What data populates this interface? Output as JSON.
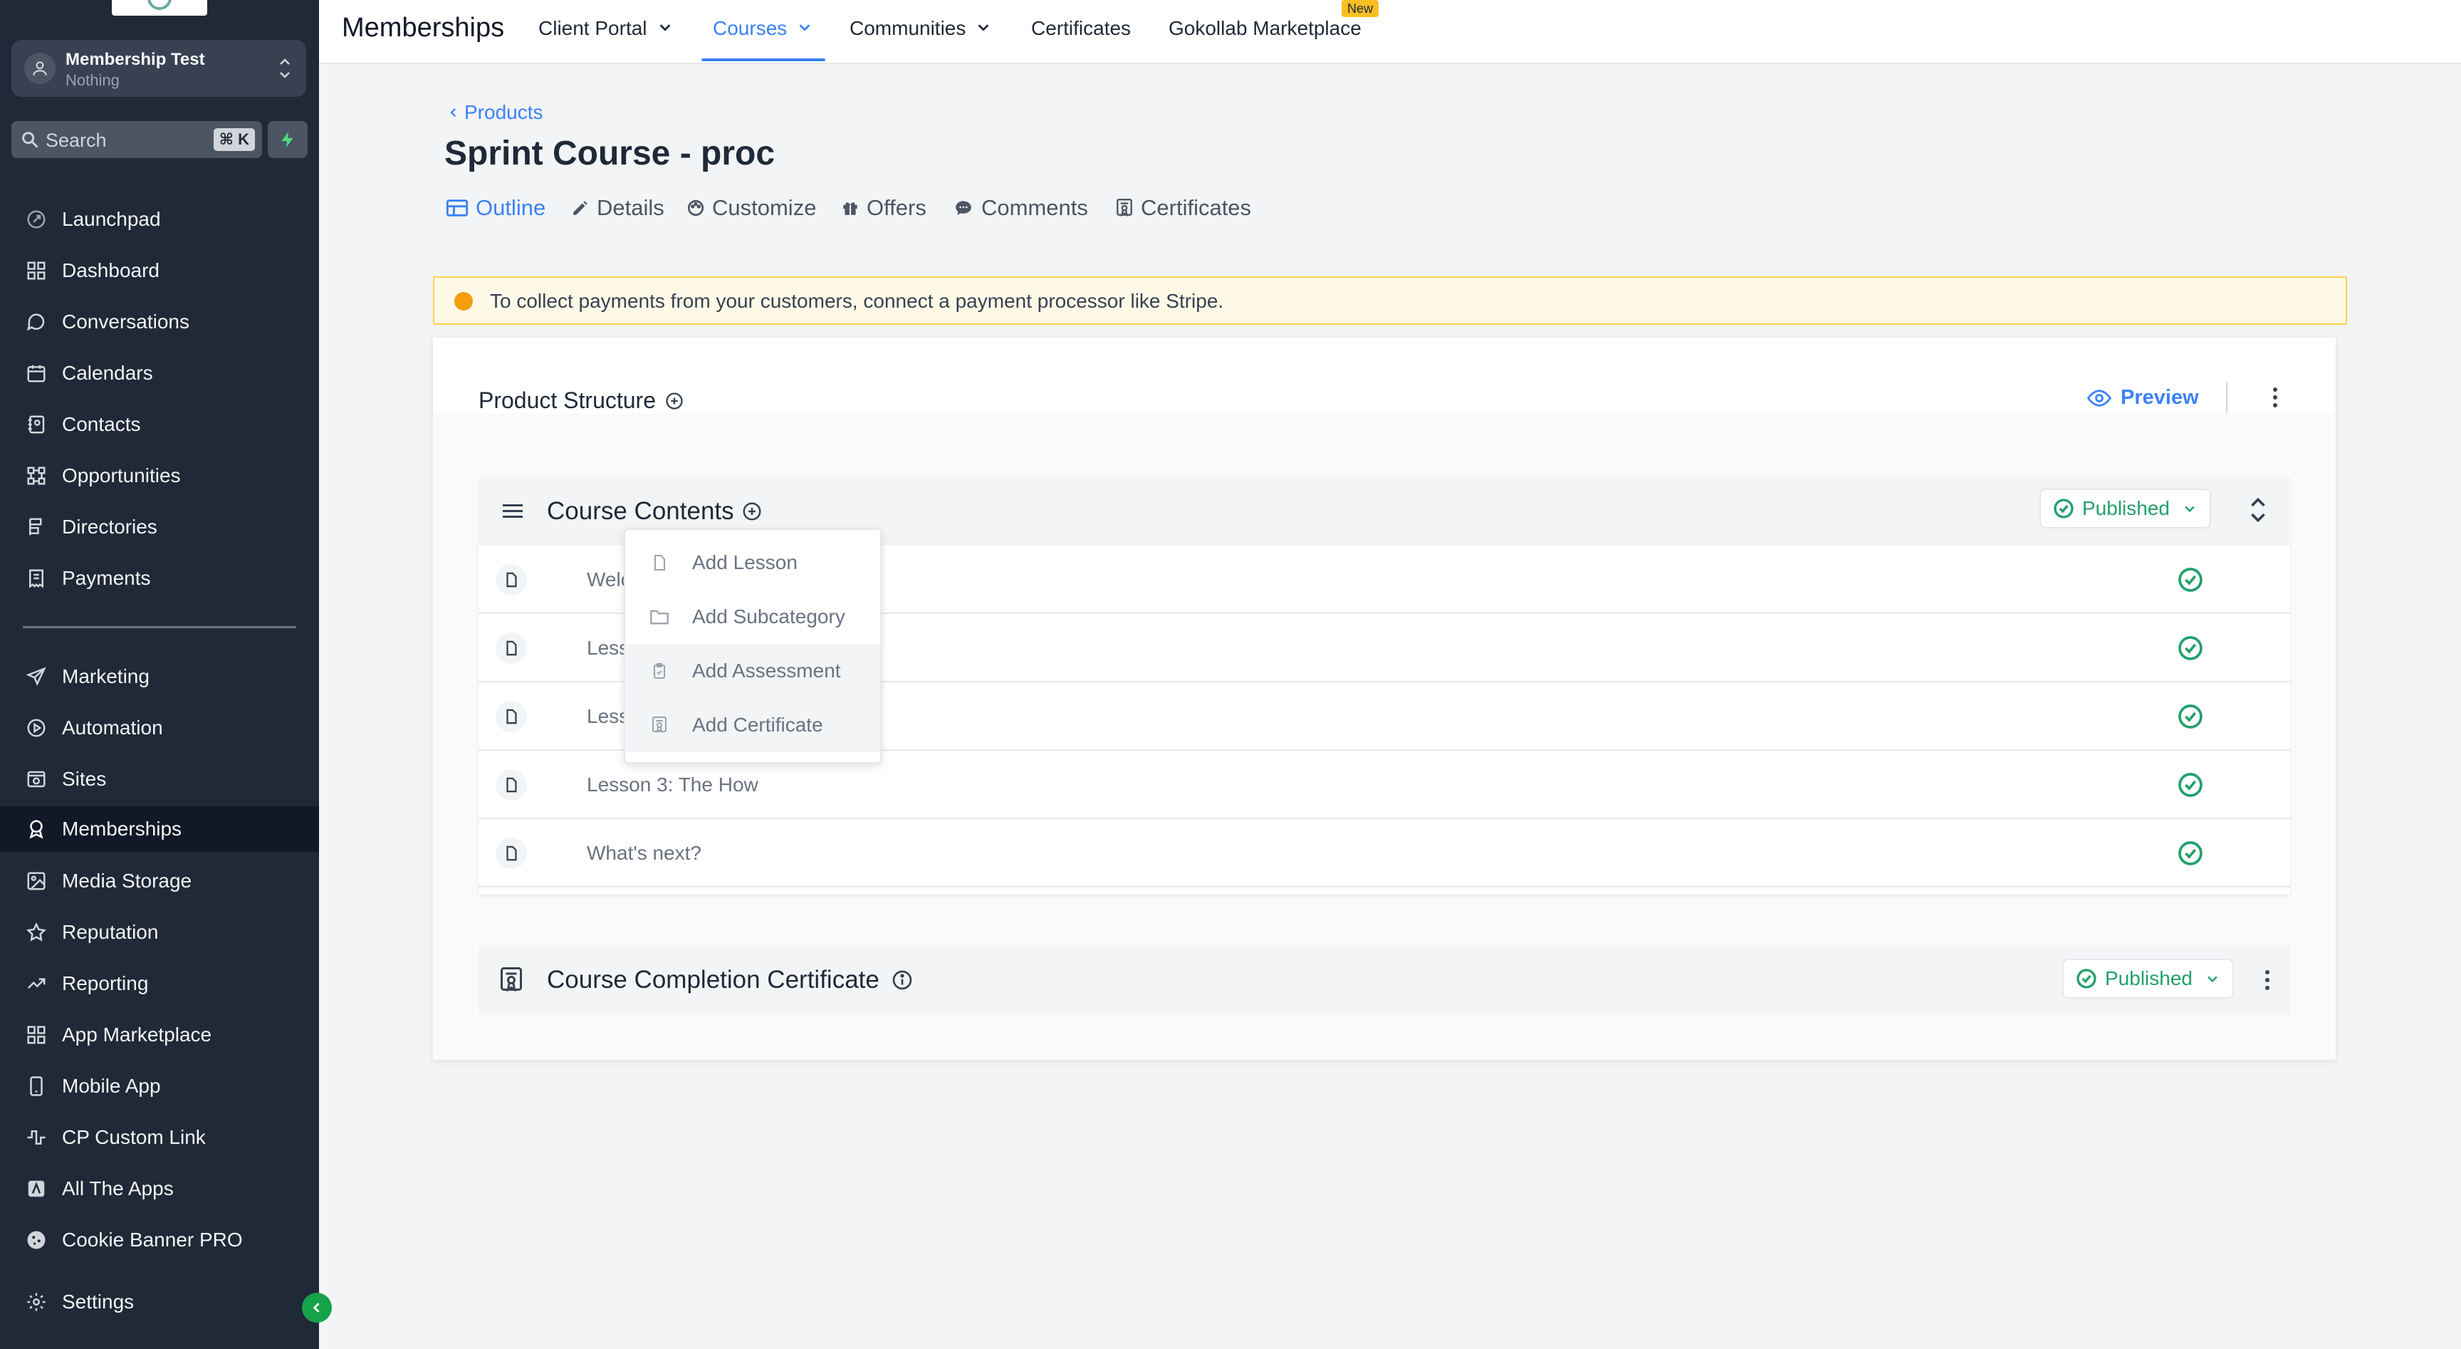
{
  "account": {
    "name": "Membership Test",
    "subtitle": "Nothing"
  },
  "search": {
    "placeholder": "Search",
    "shortcut": "⌘ K"
  },
  "sidebar": {
    "items": [
      {
        "label": "Launchpad",
        "icon": "rocket-icon"
      },
      {
        "label": "Dashboard",
        "icon": "grid-icon"
      },
      {
        "label": "Conversations",
        "icon": "chat-icon"
      },
      {
        "label": "Calendars",
        "icon": "calendar-icon"
      },
      {
        "label": "Contacts",
        "icon": "contacts-icon"
      },
      {
        "label": "Opportunities",
        "icon": "opportunities-icon"
      },
      {
        "label": "Directories",
        "icon": "directories-icon"
      },
      {
        "label": "Payments",
        "icon": "receipt-icon"
      },
      {
        "label": "Marketing",
        "icon": "send-icon"
      },
      {
        "label": "Automation",
        "icon": "automation-icon"
      },
      {
        "label": "Sites",
        "icon": "sites-icon"
      },
      {
        "label": "Memberships",
        "icon": "award-icon"
      },
      {
        "label": "Media Storage",
        "icon": "image-icon"
      },
      {
        "label": "Reputation",
        "icon": "star-icon"
      },
      {
        "label": "Reporting",
        "icon": "trend-icon"
      },
      {
        "label": "App Marketplace",
        "icon": "apps-icon"
      },
      {
        "label": "Mobile App",
        "icon": "mobile-icon"
      },
      {
        "label": "CP Custom Link",
        "icon": "pulse-icon"
      },
      {
        "label": "All The Apps",
        "icon": "app-tile-icon"
      },
      {
        "label": "Cookie Banner PRO",
        "icon": "cookie-icon"
      },
      {
        "label": "Settings",
        "icon": "gear-icon"
      }
    ],
    "active": "Memberships"
  },
  "topbar": {
    "title": "Memberships",
    "nav": [
      {
        "label": "Client Portal",
        "dropdown": true
      },
      {
        "label": "Courses",
        "dropdown": true,
        "active": true
      },
      {
        "label": "Communities",
        "dropdown": true
      },
      {
        "label": "Certificates",
        "dropdown": false
      },
      {
        "label": "Gokollab Marketplace",
        "dropdown": false,
        "badge": "New"
      }
    ]
  },
  "page": {
    "breadcrumb": "Products",
    "title": "Sprint Course - proc",
    "tabs": [
      {
        "label": "Outline",
        "icon": "outline-icon",
        "active": true
      },
      {
        "label": "Details",
        "icon": "pencil-icon"
      },
      {
        "label": "Customize",
        "icon": "palette-icon"
      },
      {
        "label": "Offers",
        "icon": "gift-icon"
      },
      {
        "label": "Comments",
        "icon": "comment-icon"
      },
      {
        "label": "Certificates",
        "icon": "certificate-icon"
      }
    ]
  },
  "alert": {
    "message": "To collect payments from your customers, connect a payment processor like Stripe."
  },
  "structure": {
    "title": "Product Structure",
    "preview_label": "Preview",
    "category": {
      "title": "Course Contents",
      "status": "Published",
      "lessons": [
        {
          "title": "Welc",
          "status": "published"
        },
        {
          "title": "Less",
          "status": "published"
        },
        {
          "title": "Less",
          "status": "published"
        },
        {
          "title": "Lesson 3: The How",
          "status": "published"
        },
        {
          "title": "What's next?",
          "status": "published"
        }
      ]
    },
    "certificate": {
      "title": "Course Completion Certificate",
      "status": "Published"
    }
  },
  "add_menu": {
    "items": [
      {
        "label": "Add Lesson",
        "icon": "file-icon"
      },
      {
        "label": "Add Subcategory",
        "icon": "folder-icon"
      },
      {
        "label": "Add Assessment",
        "icon": "clipboard-icon"
      },
      {
        "label": "Add Certificate",
        "icon": "certificate-icon"
      }
    ]
  },
  "colors": {
    "sidebar_bg": "#1f2937",
    "accent": "#3b82f6",
    "published": "#22a06b",
    "alert_bg": "#fef9e7",
    "alert_dot": "#f59e0b"
  }
}
